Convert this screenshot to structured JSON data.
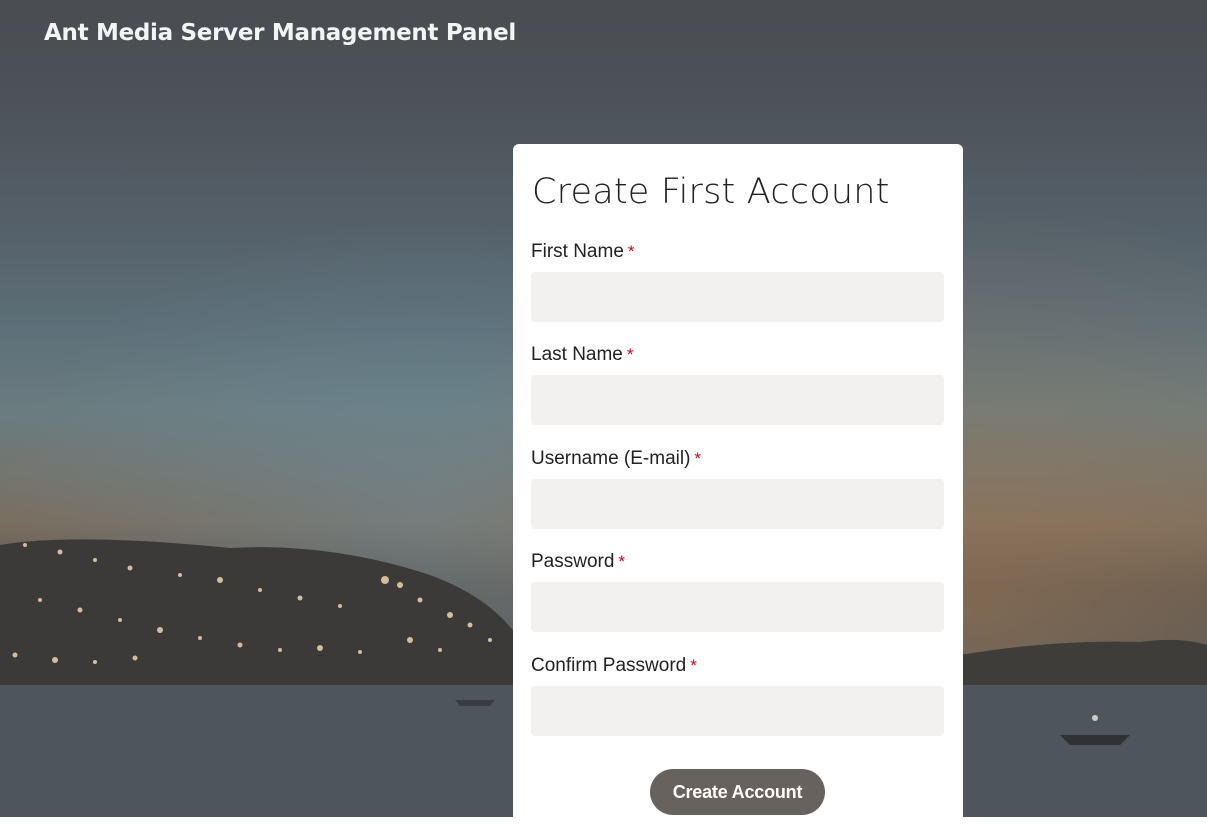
{
  "header": {
    "title": "Ant Media Server Management Panel"
  },
  "form": {
    "title": "Create First Account",
    "required_marker": "*",
    "fields": [
      {
        "label": "First Name",
        "value": "",
        "placeholder": ""
      },
      {
        "label": "Last Name",
        "value": "",
        "placeholder": ""
      },
      {
        "label": "Username (E-mail)",
        "value": "",
        "placeholder": ""
      },
      {
        "label": "Password",
        "value": "",
        "placeholder": ""
      },
      {
        "label": "Confirm Password",
        "value": "",
        "placeholder": ""
      }
    ],
    "submit_label": "Create Account"
  },
  "colors": {
    "button": "#67625d",
    "input_background": "#f2f1ef",
    "required": "#d0021b",
    "card": "#ffffff"
  }
}
